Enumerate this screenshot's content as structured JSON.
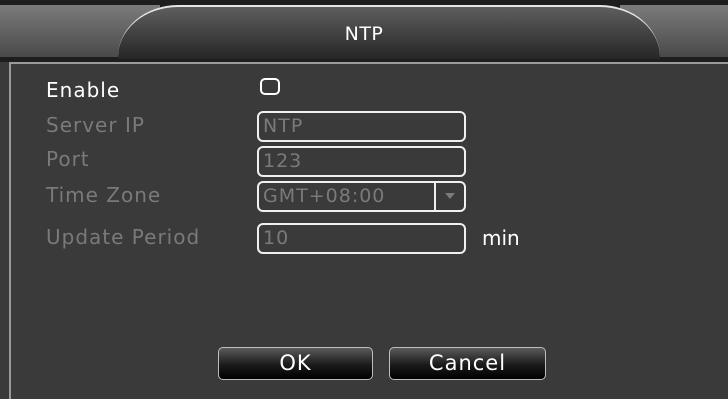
{
  "window": {
    "title": "NTP"
  },
  "form": {
    "enable": {
      "label": "Enable",
      "checked": false
    },
    "server_ip": {
      "label": "Server IP",
      "value": "NTP"
    },
    "port": {
      "label": "Port",
      "value": "123"
    },
    "time_zone": {
      "label": "Time Zone",
      "value": "GMT+08:00"
    },
    "update_period": {
      "label": "Update Period",
      "value": "10",
      "unit": "min"
    }
  },
  "buttons": {
    "ok": "OK",
    "cancel": "Cancel"
  },
  "colors": {
    "background": "#3a3a3a",
    "title_bar": "#1e1e1e",
    "active_text": "#ffffff",
    "disabled_text": "#7a7a7a"
  }
}
